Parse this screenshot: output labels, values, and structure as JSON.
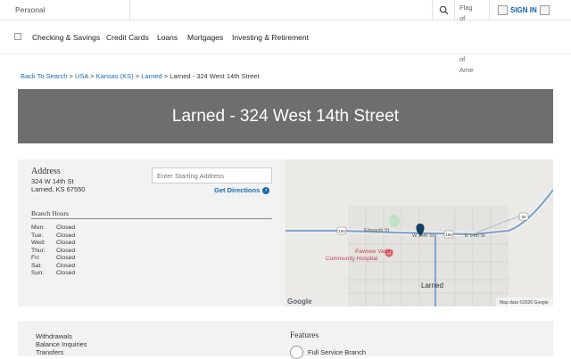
{
  "topbar": {
    "segment": "Personal",
    "flag_alt": "Flag of the United States of America",
    "signin_label": "SIGN IN"
  },
  "nav": {
    "items": [
      "Checking & Savings",
      "Credit Cards",
      "Loans",
      "Mortgages",
      "Investing & Retirement"
    ]
  },
  "breadcrumb": {
    "items": [
      "Back To Search",
      "USA",
      "Kansas (KS)",
      "Larned"
    ],
    "current": "Larned - 324 West 14th Street",
    "separator": ">"
  },
  "hero": {
    "title": "Larned - 324 West 14th Street"
  },
  "address": {
    "heading": "Address",
    "line1": "324 W 14th St",
    "line2": "Larned, KS 67550"
  },
  "directions": {
    "placeholder": "Enter Starting Address",
    "button": "Get Directions"
  },
  "hours": {
    "heading": "Branch Hours",
    "rows": [
      {
        "day": "Mon:",
        "status": "Closed"
      },
      {
        "day": "Tue:",
        "status": "Closed"
      },
      {
        "day": "Wed:",
        "status": "Closed"
      },
      {
        "day": "Thur:",
        "status": "Closed"
      },
      {
        "day": "Fri:",
        "status": "Closed"
      },
      {
        "day": "Sat:",
        "status": "Closed"
      },
      {
        "day": "Sun:",
        "status": "Closed"
      }
    ]
  },
  "map": {
    "labels": {
      "edwards": "Edwards St",
      "w14": "W 14th St",
      "e14": "E 14th St",
      "hospital_line1": "Pawnee Valley",
      "hospital_line2": "Community Hospital",
      "town": "Larned",
      "hwy156a": "156",
      "hwy156b": "156",
      "hwy56": "56",
      "google": "Google",
      "attribution": "Map data ©2026 Google"
    }
  },
  "services": {
    "items": [
      "Withdrawals",
      "Balance Inquiries",
      "Transfers"
    ]
  },
  "features": {
    "heading": "Features",
    "first": "Full Service Branch"
  },
  "colors": {
    "accent": "#0b63b1",
    "hero_bg": "#6e6e6e",
    "panel_bg": "#f2f2f2",
    "pin": "#16415f"
  }
}
